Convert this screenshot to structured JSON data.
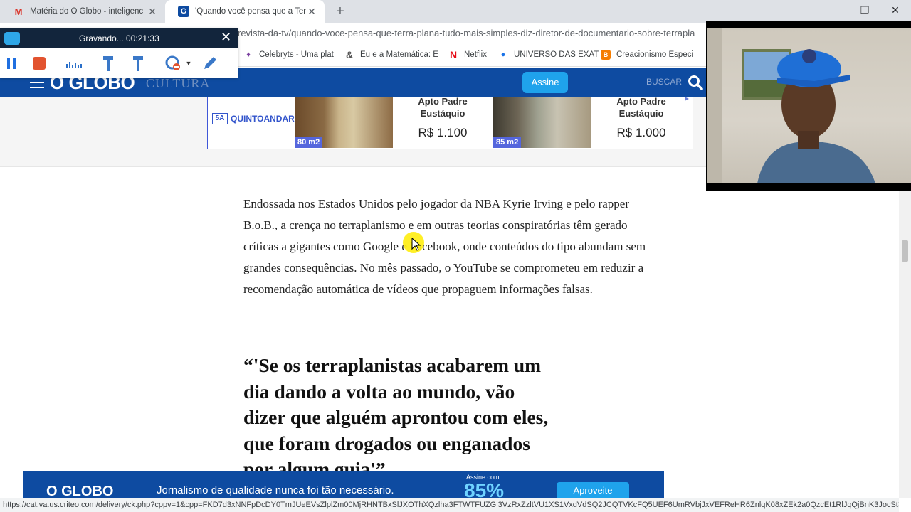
{
  "browser": {
    "tabs": [
      {
        "title": "Matéria do O Globo - inteligenc",
        "favicon": "gmail-icon"
      },
      {
        "title": "'Quando você pensa que a Terra",
        "favicon": "oglobo-icon"
      }
    ],
    "url": "revista-da-tv/quando-voce-pensa-que-terra-plana-tudo-mais-simples-diz-diretor-de-documentario-sobre-terrapla",
    "bookmarks": [
      "Celebryts - Uma plat",
      "Eu e a Matemática: E",
      "Netflix",
      "UNIVERSO DAS EXAT",
      "Creacionismo Especi"
    ]
  },
  "recorder": {
    "status": "Gravando... 00:21:33"
  },
  "site": {
    "logo": "O GLOBO",
    "section": "CULTURA",
    "subscribe_label": "Assine",
    "search_label": "BUSCAR"
  },
  "ad": {
    "brand": "QUINTOANDAR",
    "listings": [
      {
        "area": "80 m2",
        "title_line1": "Apto Padre",
        "title_line2": "Eustáquio",
        "price": "R$ 1.100"
      },
      {
        "area": "85 m2",
        "title_line1": "Apto Padre",
        "title_line2": "Eustáquio",
        "price": "R$ 1.000"
      }
    ]
  },
  "article": {
    "paragraph": "Endossada nos Estados Unidos pelo jogador da NBA Kyrie Irving e pelo rapper B.o.B., a crença no terraplanismo e em outras teorias conspiratórias têm gerado críticas a gigantes como Google e Facebook, onde conteúdos do tipo abundam sem grandes consequências. No mês passado, o YouTube se comprometeu em reduzir a recomendação automática de vídeos que propaguem informações falsas.",
    "quote": "“'Se os terraplanistas acabarem um dia dando a volta ao mundo, vão dizer que alguém aprontou com eles, que foram drogados ou enganados por algum guia'”"
  },
  "banner": {
    "logo": "O GLOBO",
    "slogan": "Jornalismo de qualidade nunca foi tão necessário.",
    "offer_label": "Assine com",
    "offer_value": "85%",
    "cta": "Aproveite"
  },
  "status_url": "https://cat.va.us.criteo.com/delivery/ck.php?cppv=1&cpp=FKD7d3xNNFpDcDY0TmJUeEVsZlplZm00MjRHNTBxSlJXOThXQzlha3FTWTFUZGl3VzRxZzltVU1XS1VxdVdSQ2JCQTVKcFQ5UEF6UmRVbjJxVEFReHR6ZnlqK08xZEk2a0QzcEt1RlJqQjBnK3JocSt3R3pG...",
  "colors": {
    "brand_blue": "#0e4ba1",
    "accent_blue": "#1fa3ec",
    "cursor_highlight": "#ffec00"
  }
}
